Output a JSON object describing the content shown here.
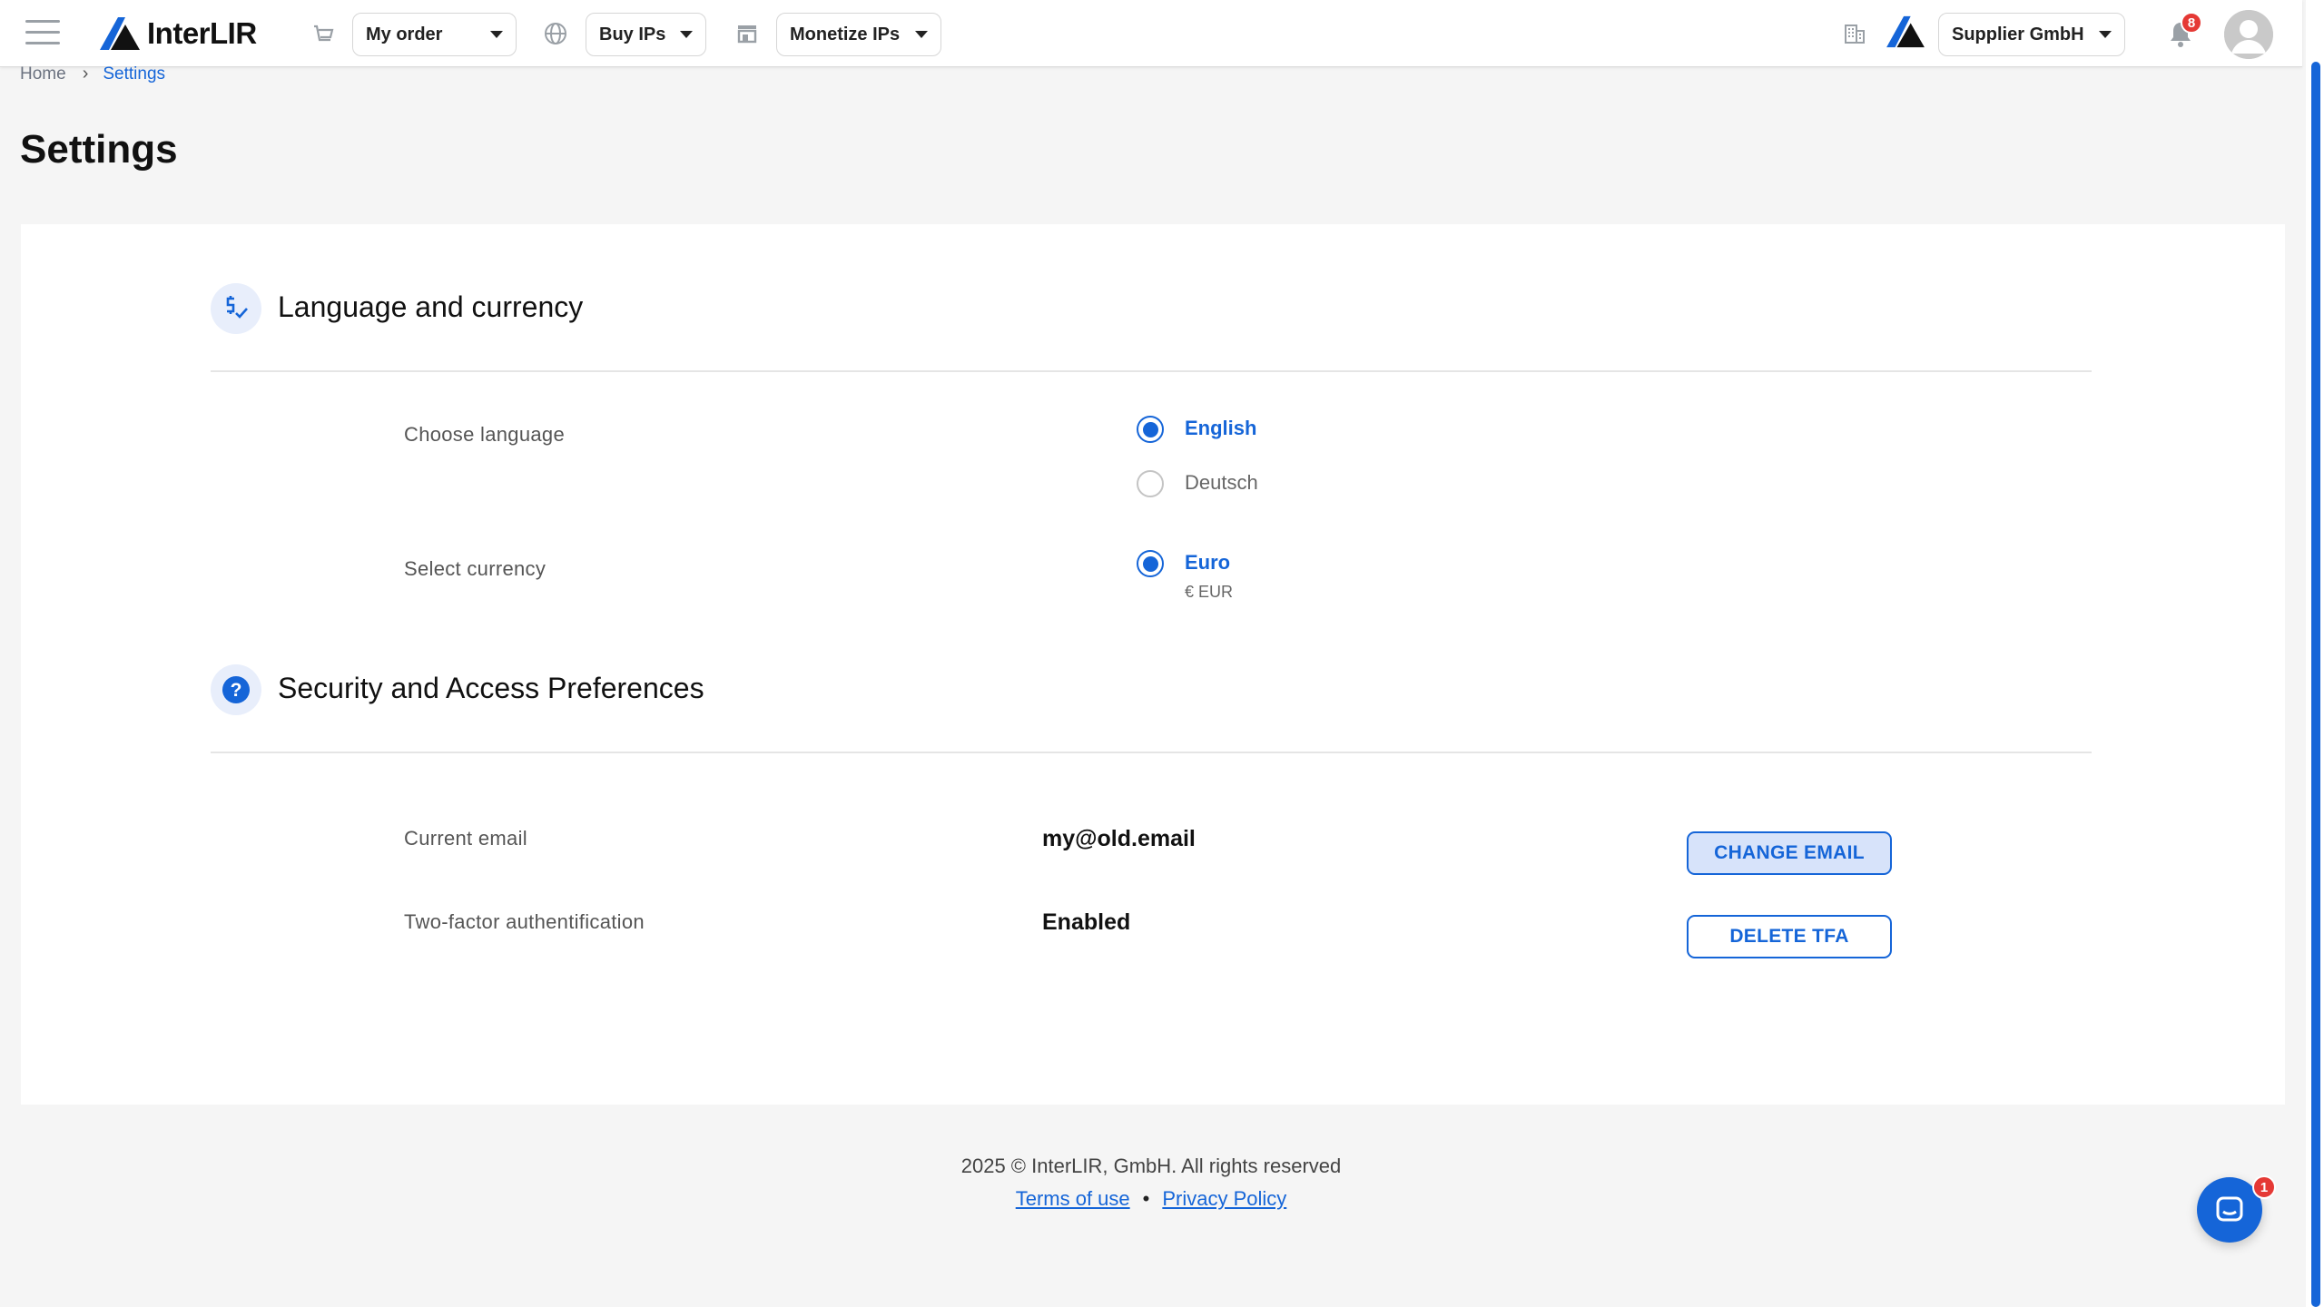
{
  "colors": {
    "accent": "#1565d8",
    "badge": "#e53935",
    "page_background": "#f5f5f5",
    "card_background": "#ffffff"
  },
  "header": {
    "logo_text": "InterLIR",
    "menu_icon": "hamburger-icon",
    "nav": [
      {
        "icon": "cart-icon",
        "label": "My order"
      },
      {
        "icon": "globe-icon",
        "label": "Buy IPs"
      },
      {
        "icon": "store-icon",
        "label": "Monetize IPs"
      }
    ],
    "company": {
      "icon": "building-icon",
      "label": "Supplier GmbH"
    },
    "notifications": {
      "icon": "bell-icon",
      "count": "8"
    },
    "avatar_icon": "user-avatar-icon"
  },
  "breadcrumb": {
    "home": "Home",
    "separator": "›",
    "current": "Settings"
  },
  "page": {
    "title": "Settings"
  },
  "language_currency": {
    "icon": "currency-check-icon",
    "title": "Language and currency",
    "language_label": "Choose language",
    "languages": [
      {
        "label": "English",
        "selected": true
      },
      {
        "label": "Deutsch",
        "selected": false
      }
    ],
    "currency_label": "Select currency",
    "currency": {
      "label": "Euro",
      "sub": "€ EUR",
      "selected": true
    }
  },
  "security": {
    "icon": "question-icon",
    "title": "Security and Access Preferences",
    "email_label": "Current email",
    "email_value": "my@old.email",
    "change_email_button": "CHANGE EMAIL",
    "tfa_label": "Two-factor authentification",
    "tfa_value": "Enabled",
    "delete_tfa_button": "DELETE TFA"
  },
  "footer": {
    "copyright": "2025 © InterLIR, GmbH. All rights reserved",
    "terms": "Terms of use",
    "separator": "•",
    "privacy": "Privacy Policy"
  },
  "chat": {
    "icon": "chat-icon",
    "badge": "1"
  }
}
